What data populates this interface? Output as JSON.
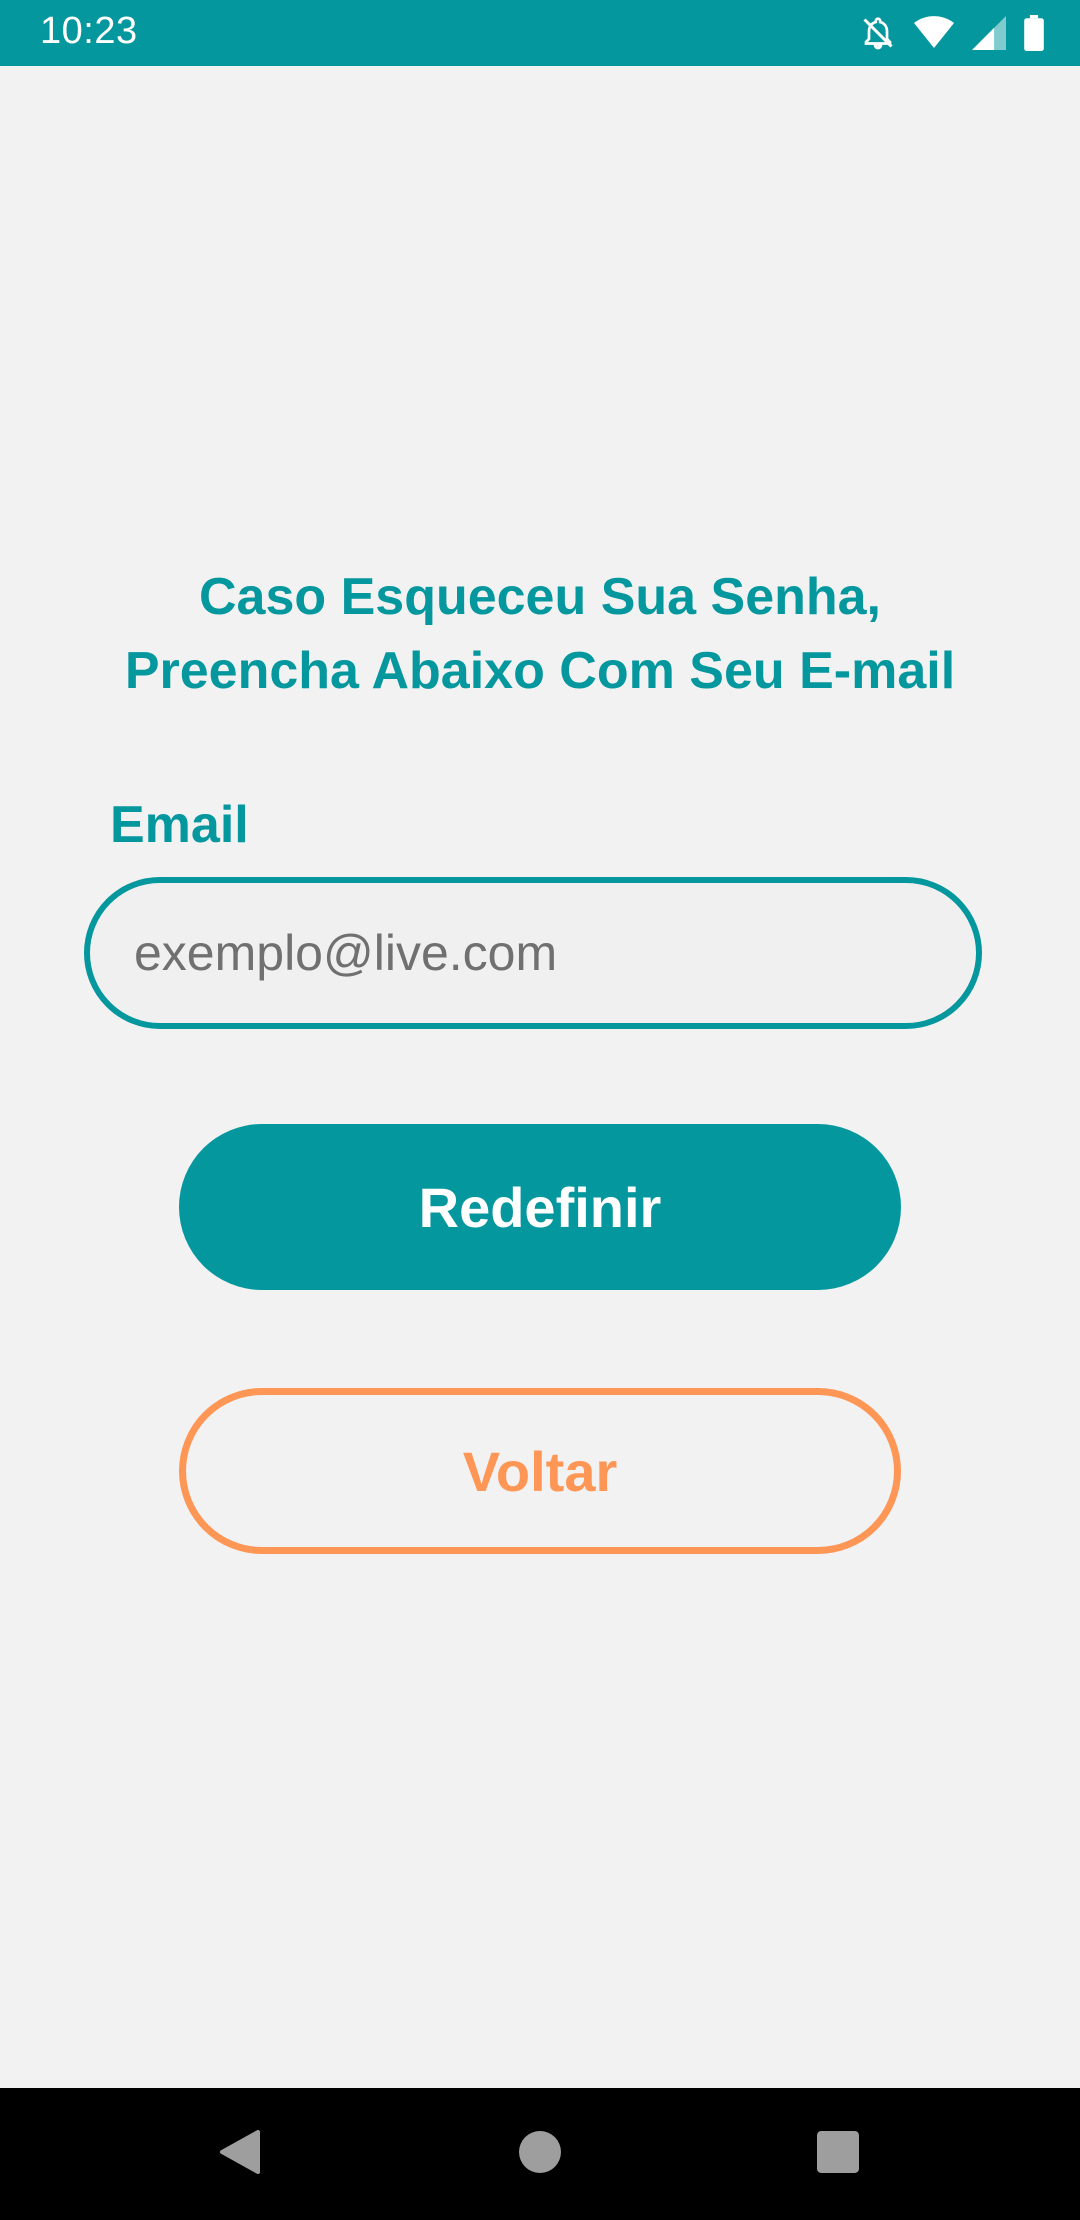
{
  "status_bar": {
    "time": "10:23",
    "icons": [
      "notifications-off-icon",
      "wifi-icon",
      "signal-icon",
      "battery-icon"
    ],
    "background": "#04979e"
  },
  "screen": {
    "title_line1": "Caso Esqueceu Sua Senha,",
    "title_line2": "Preencha Abaixo Com Seu E-mail",
    "email_label": "Email",
    "email_placeholder": "exemplo@live.com",
    "email_value": "",
    "reset_button": "Redefinir",
    "back_button": "Voltar"
  },
  "nav_bar": {
    "icons": [
      "back-icon",
      "home-icon",
      "recents-icon"
    ]
  },
  "colors": {
    "primary": "#04979e",
    "secondary": "#fe9655",
    "background": "#f2f2f2"
  }
}
